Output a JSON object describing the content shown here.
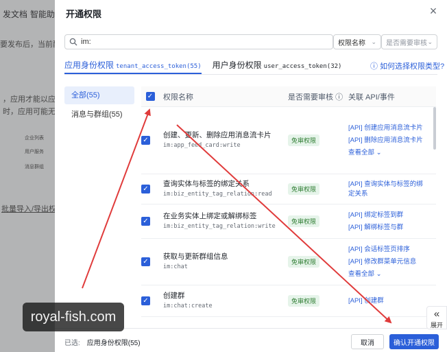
{
  "background": {
    "nav_items": [
      "发文档",
      "智能助手"
    ],
    "line1": "要发布后，当前配置",
    "line2": "，应用才能以应用身",
    "line3": "时，应用可能无法",
    "diagram_labels": [
      "企业列表",
      "用户服务",
      "消息群组"
    ],
    "batch_link": "批量导入/导出权限"
  },
  "modal": {
    "title": "开通权限",
    "search": {
      "value": "im:"
    },
    "filter_select": {
      "value": "权限名称"
    },
    "review_select": {
      "placeholder": "是否需要审核"
    },
    "tabs": [
      {
        "label": "应用身份权限",
        "code": "tenant_access_token(55)"
      },
      {
        "label": "用户身份权限",
        "code": "user_access_token(32)"
      }
    ],
    "help_link": "如何选择权限类型?",
    "side_nav": [
      {
        "label": "全部(55)"
      },
      {
        "label": "消息与群组(55)"
      }
    ],
    "table": {
      "headers": {
        "name": "权限名称",
        "review": "是否需要审核",
        "api": "关联 API/事件"
      },
      "rows": [
        {
          "name": "创建、更新、删除应用消息流卡片",
          "code": "im:app_feed_card:write",
          "review": "免审权限",
          "apis": [
            "[API] 创建应用消息流卡片",
            "[API] 删除应用消息流卡片"
          ],
          "more": "查看全部"
        },
        {
          "name": "查询实体与标签的绑定关系",
          "code": "im:biz_entity_tag_relation:read",
          "review": "免审权限",
          "apis": [
            "[API] 查询实体与标签的绑定关系"
          ],
          "more": ""
        },
        {
          "name": "在业务实体上绑定或解绑标签",
          "code": "im:biz_entity_tag_relation:write",
          "review": "免审权限",
          "apis": [
            "[API] 绑定标签到群",
            "[API] 解绑标签与群"
          ],
          "more": ""
        },
        {
          "name": "获取与更新群组信息",
          "code": "im:chat",
          "review": "免审权限",
          "apis": [
            "[API] 会话标签页排序",
            "[API] 修改群菜单元信息"
          ],
          "more": "查看全部"
        },
        {
          "name": "创建群",
          "code": "im:chat:create",
          "review": "免审权限",
          "apis": [
            "[API] 创建群"
          ],
          "more": ""
        }
      ]
    },
    "footer": {
      "selected_label": "已选:",
      "selected_value": "应用身份权限(55)",
      "cancel": "取消",
      "confirm": "确认开通权限"
    }
  },
  "expand": {
    "label": "展开"
  },
  "watermark": "royal-fish.com",
  "colors": {
    "accent": "#2b5fd9",
    "badge_bg": "#e6f4ea",
    "badge_text": "#2f7d32",
    "annotation": "#e03b3b"
  }
}
